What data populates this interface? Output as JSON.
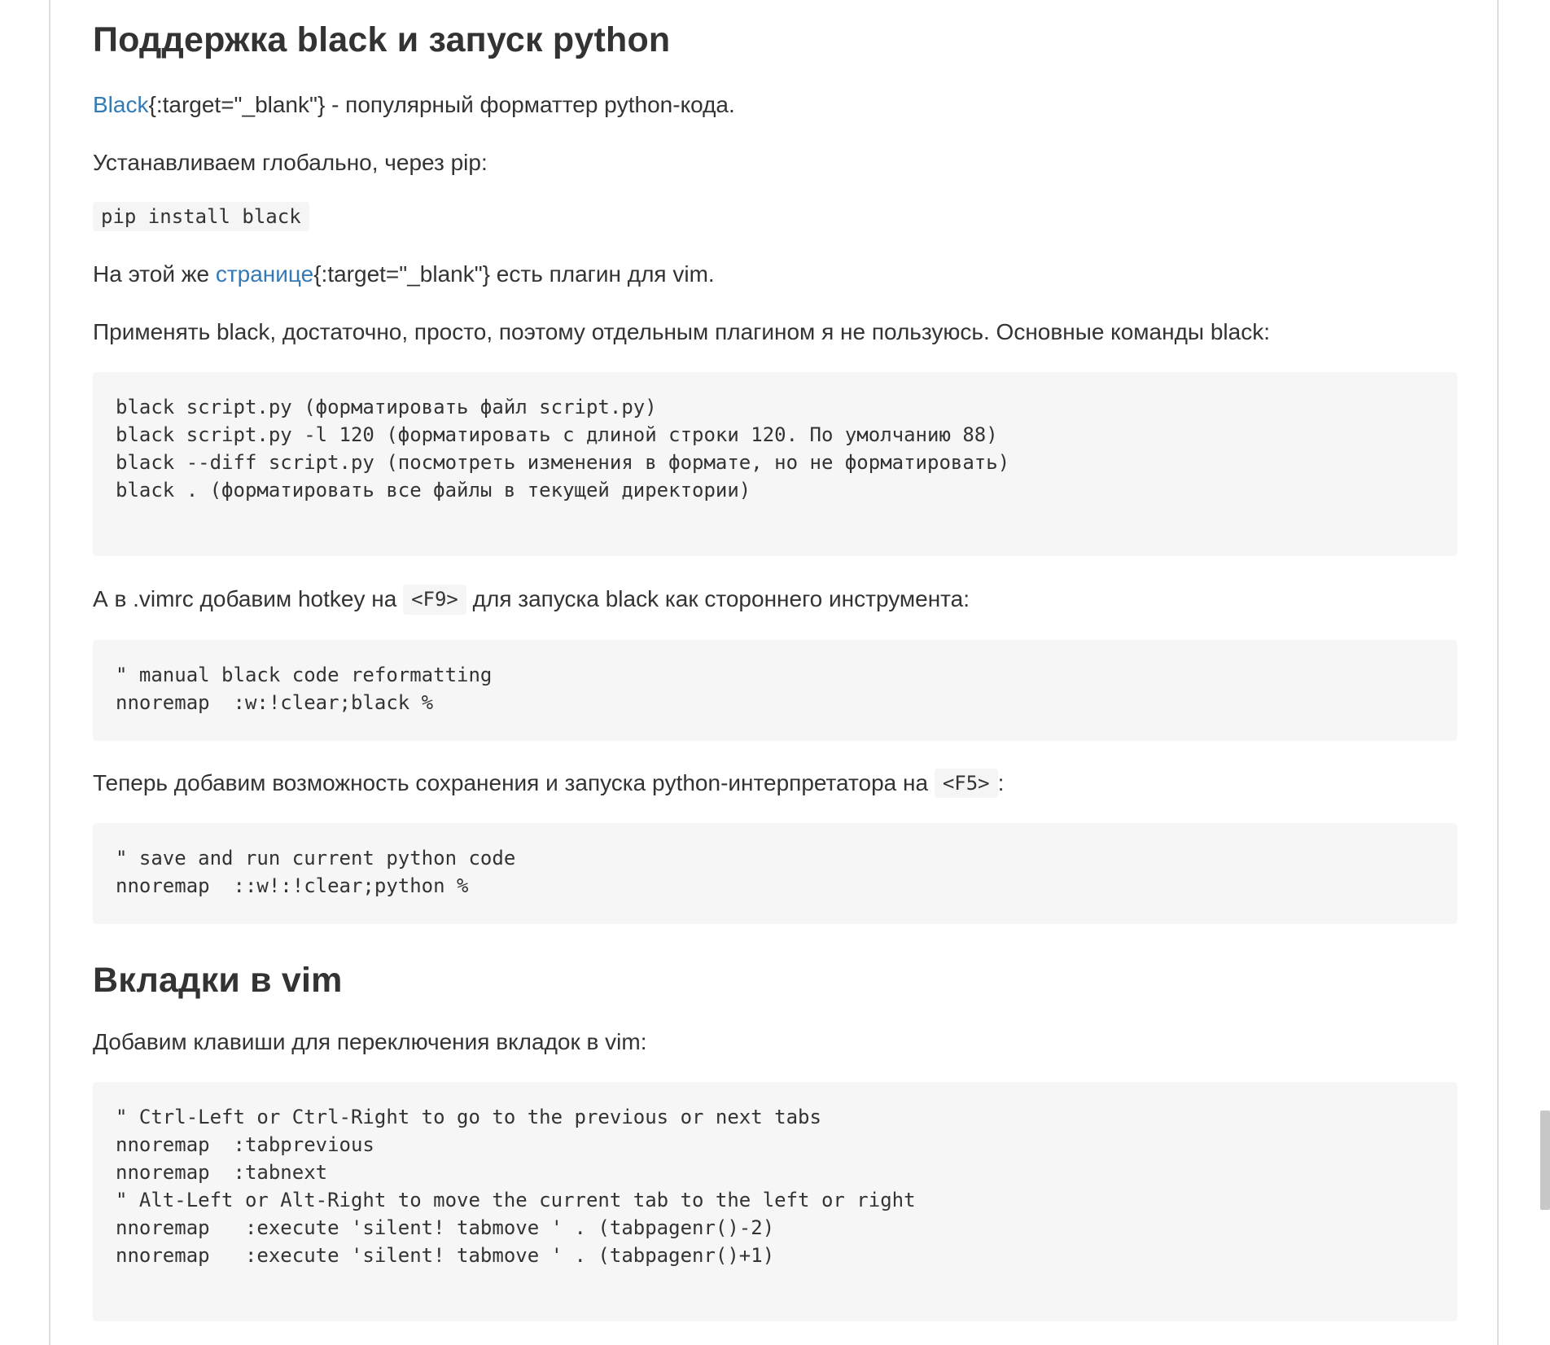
{
  "section_black": {
    "heading": "Поддержка black и запуск python",
    "p1": {
      "link": "Black",
      "rest": "{:target=\"_blank\"} - популярный форматтер python-кода."
    },
    "p2": "Устанавливаем глобально, через pip:",
    "install_cmd": "pip install black",
    "p3": {
      "before": "На этой же ",
      "link": "странице",
      "after": "{:target=\"_blank\"} есть плагин для vim."
    },
    "p4": "Применять black, достаточно, просто, поэтому отдельным плагином я не пользуюсь. Основные команды black:",
    "commands_code": [
      "black script.py (форматировать файл script.py)",
      "black script.py -l 120 (форматировать с длиной строки 120. По умолчанию 88)",
      "black --diff script.py (посмотреть изменения в формате, но не форматировать)",
      "black . (форматировать все файлы в текущей директории)"
    ],
    "p5": {
      "before": "А в .vimrc добавим hotkey на ",
      "key": "<F9>",
      "after": " для запуска black как стороннего инструмента:"
    },
    "black_hotkey_code": [
      "\" manual black code reformatting",
      "nnoremap  :w:!clear;black %"
    ],
    "p6": {
      "before": "Теперь добавим возможность сохранения и запуска python-интерпретатора на ",
      "key": "<F5>",
      "after": ":"
    },
    "run_python_code": [
      "\" save and run current python code",
      "nnoremap  ::w!:!clear;python %"
    ]
  },
  "section_tabs": {
    "heading": "Вкладки в vim",
    "p1": "Добавим клавиши для переключения вкладок в vim:",
    "tabs_code": [
      "\" Ctrl-Left or Ctrl-Right to go to the previous or next tabs",
      "nnoremap  :tabprevious",
      "nnoremap  :tabnext",
      "\" Alt-Left or Alt-Right to move the current tab to the left or right",
      "nnoremap   :execute 'silent! tabmove ' . (tabpagenr()-2)",
      "nnoremap   :execute 'silent! tabmove ' . (tabpagenr()+1)"
    ]
  },
  "colors": {
    "link": "#337ab7",
    "text": "#333333",
    "code_bg": "#f6f6f6"
  }
}
